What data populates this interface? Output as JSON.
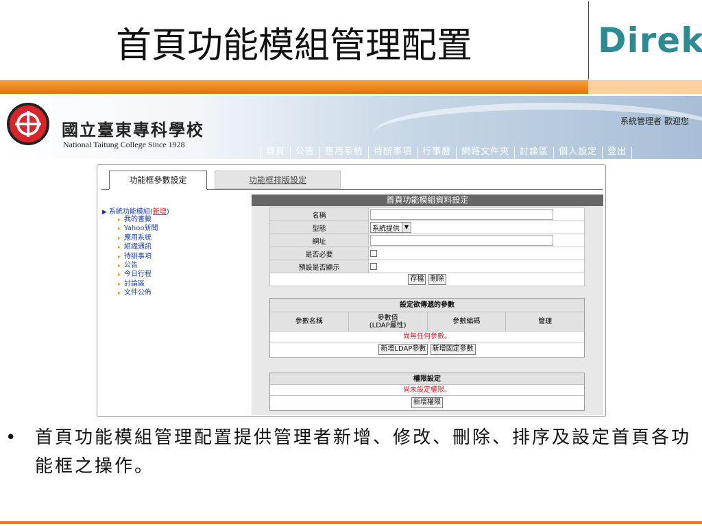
{
  "slide": {
    "title": "首頁功能模組管理配置",
    "brand": "Direk",
    "bullet": "首頁功能模組管理配置提供管理者新增、修改、刪除、排序及設定首頁各功能框之操作。"
  },
  "portal": {
    "college_name_cn": "國立臺東專科學校",
    "college_name_en": "National Taitung College Since 1928",
    "welcome": "系統管理者 歡迎您",
    "nav": [
      "首頁",
      "公告",
      "應用系統",
      "待辦事項",
      "行事曆",
      "網路文件夾",
      "討論區",
      "個人設定",
      "登出"
    ]
  },
  "tabs": {
    "active": "功能框參數設定",
    "inactive": "功能框排版設定"
  },
  "sidebar": {
    "root_label": "系統功能模組",
    "root_add_open": "(",
    "root_add": "新增",
    "root_add_close": ")",
    "items": [
      "我的書籤",
      "Yahoo新聞",
      "應用系統",
      "組織通訊",
      "待辦事項",
      "公告",
      "今日行程",
      "討論區",
      "文件公佈"
    ]
  },
  "form": {
    "header": "首頁功能模組資料設定",
    "name_label": "名稱",
    "name_value": "",
    "type_label": "型態",
    "type_value": "系統提供",
    "url_label": "網址",
    "url_value": "",
    "required_label": "是否必要",
    "default_label": "預設是否顯示",
    "save_button": "存檔",
    "delete_button": "刪除"
  },
  "params": {
    "header": "設定欲傳遞的參數",
    "col_name": "參數名稱",
    "col_value_line1": "參數值",
    "col_value_line2": "(LDAP屬性)",
    "col_encoding": "參數編碼",
    "col_manage": "管理",
    "empty": "尚無任何參數。",
    "add_ldap_button": "新增LDAP參數",
    "add_fixed_button": "新增固定參數"
  },
  "permissions": {
    "header": "權限設定",
    "empty": "尚未設定權限。",
    "add_button": "新增權限"
  }
}
